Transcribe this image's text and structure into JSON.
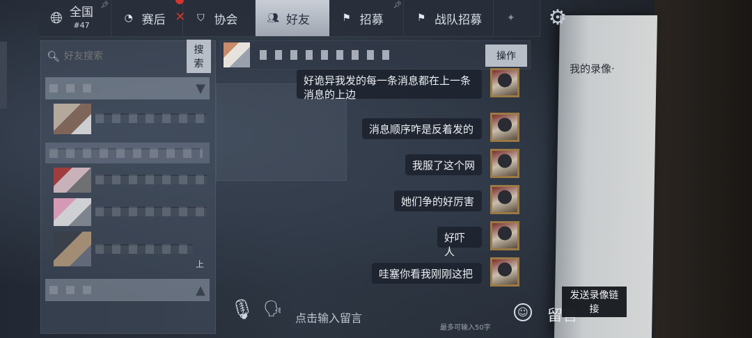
{
  "tabs": [
    {
      "label": "全国",
      "sub": "#47",
      "icon": "globe-icon"
    },
    {
      "label": "赛后",
      "icon": "clock-icon"
    },
    {
      "label": "协会",
      "icon": "shield-icon"
    },
    {
      "label": "好友",
      "icon": "friends-icon",
      "active": true
    },
    {
      "label": "招募",
      "icon": "flag-icon"
    },
    {
      "label": "战队招募",
      "icon": "team-flag-icon"
    }
  ],
  "search": {
    "placeholder": "好友搜索",
    "button": "搜索"
  },
  "chat": {
    "operate_button": "操作"
  },
  "messages": [
    {
      "text": "好诡异我发的每一条消息都在上一条消息的上边"
    },
    {
      "text": "消息顺序咋是反着发的"
    },
    {
      "text": "我服了这个网"
    },
    {
      "text": "她们争的好厉害"
    },
    {
      "text": "好吓人"
    },
    {
      "text": "哇塞你看我刚刚这把"
    }
  ],
  "input": {
    "placeholder": "点击输入留言",
    "limit": "最多可输入50字",
    "leave_label": "留言"
  },
  "send_recording_button": "发送录像链接",
  "paper_text": "我的录像·",
  "friend_list_tag": "上",
  "colors": {
    "bubble": "#1c222e",
    "active_tab": "#c9ced6",
    "accent_red": "#d8342c"
  }
}
